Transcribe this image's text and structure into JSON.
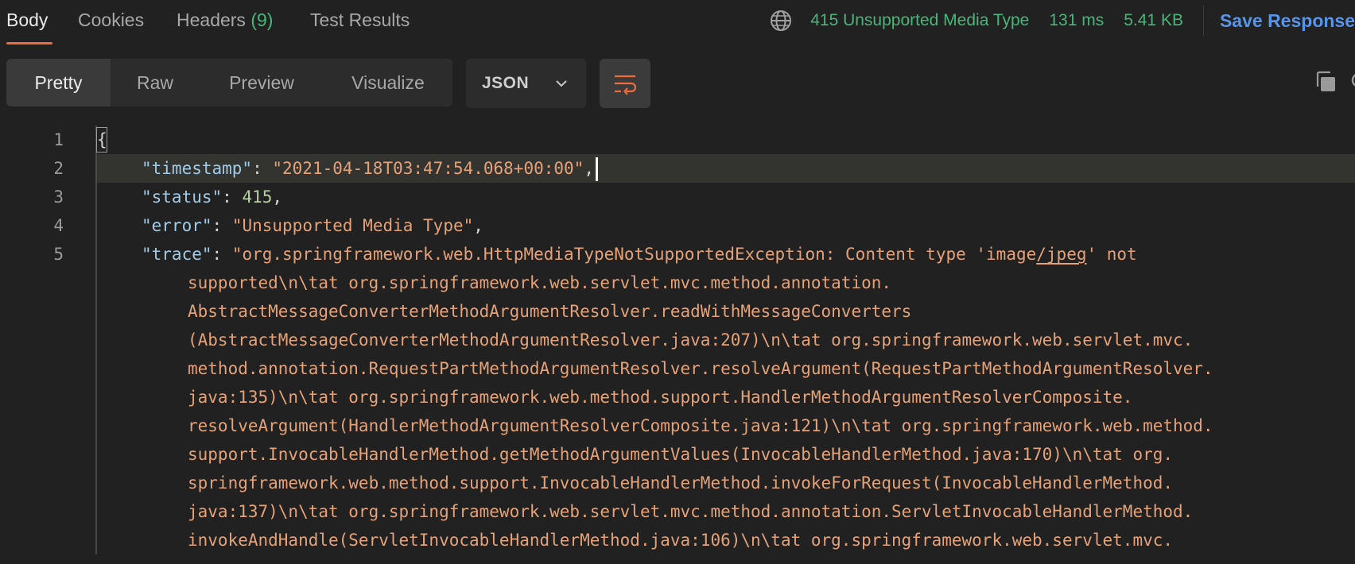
{
  "tabs": [
    {
      "label": "Body"
    },
    {
      "label": "Cookies"
    },
    {
      "label": "Headers",
      "count": "(9)"
    },
    {
      "label": "Test Results"
    }
  ],
  "status": {
    "code_text": "415 Unsupported Media Type",
    "time": "131 ms",
    "size": "5.41 KB",
    "save_label": "Save Response"
  },
  "view_modes": [
    "Pretty",
    "Raw",
    "Preview",
    "Visualize"
  ],
  "active_view": "Pretty",
  "format": "JSON",
  "icons": [
    "globe-icon",
    "chevron-down-icon",
    "wrap-lines-icon",
    "copy-icon",
    "search-icon"
  ],
  "colors": {
    "accent": "#f26b3a",
    "success": "#49b57a",
    "link": "#5a94e6"
  },
  "code": {
    "line_numbers": [
      "1",
      "2",
      "3",
      "4",
      "5"
    ],
    "open_brace": "{",
    "timestamp_key": "\"timestamp\"",
    "timestamp_value": "\"2021-04-18T03:47:54.068+00:00\"",
    "status_key": "\"status\"",
    "status_value": "415",
    "error_key": "\"error\"",
    "error_value": "\"Unsupported Media Type\"",
    "trace_key": "\"trace\"",
    "trace_first_a": "\"org.springframework.web.HttpMediaTypeNotSupportedException: Content type 'image",
    "trace_first_link": "/jpeg",
    "trace_first_b": "' not",
    "trace_wrapped": [
      "supported\\n\\tat org.springframework.web.servlet.mvc.method.annotation.",
      "AbstractMessageConverterMethodArgumentResolver.readWithMessageConverters",
      "(AbstractMessageConverterMethodArgumentResolver.java:207)\\n\\tat org.springframework.web.servlet.mvc.",
      "method.annotation.RequestPartMethodArgumentResolver.resolveArgument(RequestPartMethodArgumentResolver.",
      "java:135)\\n\\tat org.springframework.web.method.support.HandlerMethodArgumentResolverComposite.",
      "resolveArgument(HandlerMethodArgumentResolverComposite.java:121)\\n\\tat org.springframework.web.method.",
      "support.InvocableHandlerMethod.getMethodArgumentValues(InvocableHandlerMethod.java:170)\\n\\tat org.",
      "springframework.web.method.support.InvocableHandlerMethod.invokeForRequest(InvocableHandlerMethod.",
      "java:137)\\n\\tat org.springframework.web.servlet.mvc.method.annotation.ServletInvocableHandlerMethod.",
      "invokeAndHandle(ServletInvocableHandlerMethod.java:106)\\n\\tat org.springframework.web.servlet.mvc."
    ]
  }
}
